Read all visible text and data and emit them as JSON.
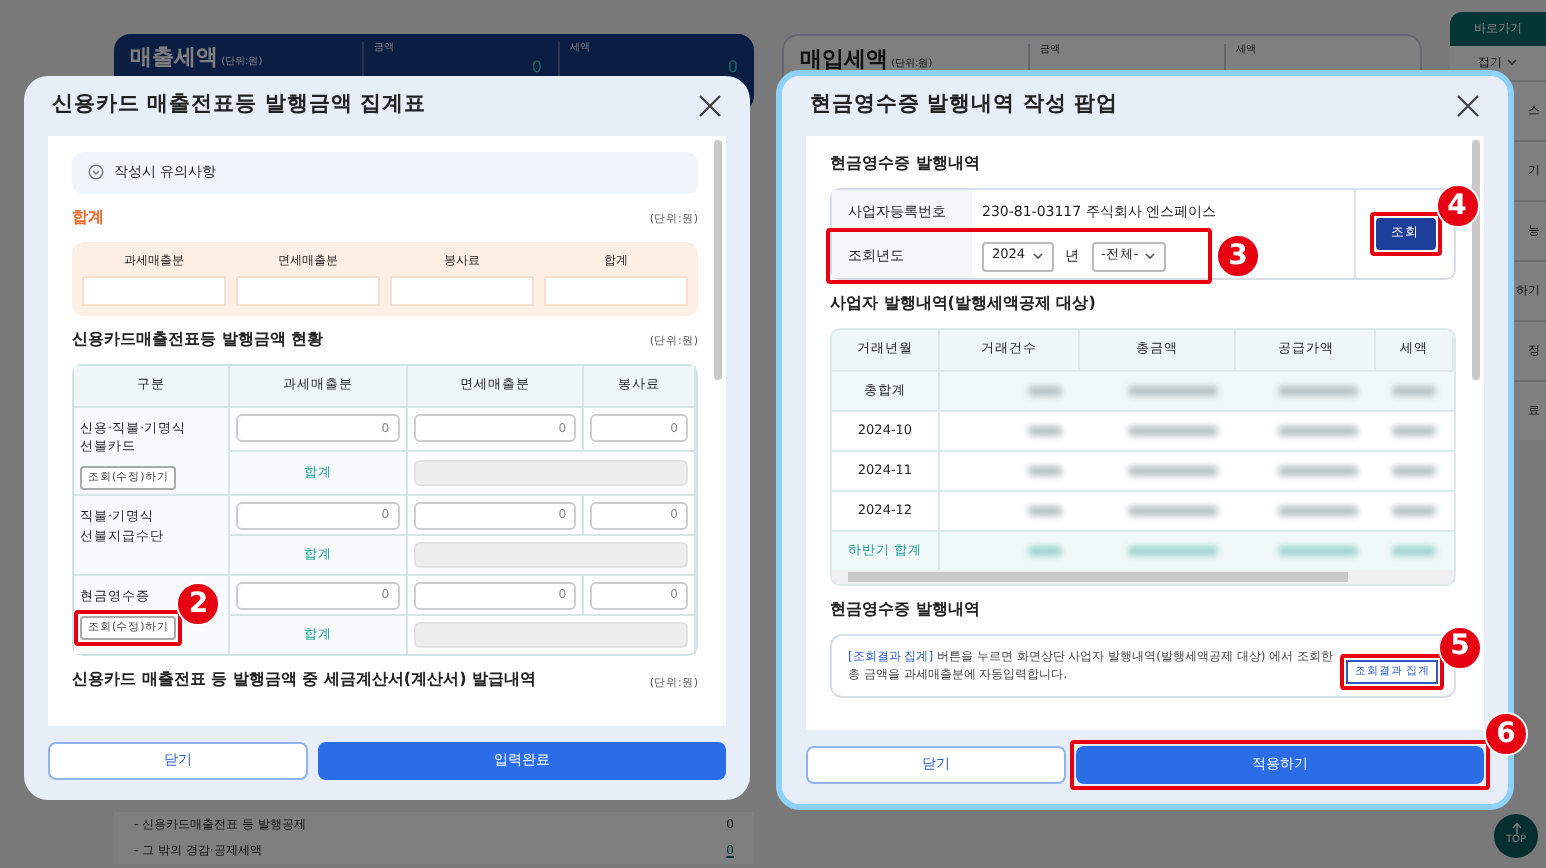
{
  "background": {
    "sales_card": {
      "title": "매출세액",
      "unit": "(단위:원)",
      "columns": [
        "금액",
        "세액"
      ],
      "values": [
        "0",
        "0"
      ]
    },
    "purchase_card": {
      "title": "매입세액",
      "unit": "(단위:원)",
      "columns": [
        "금액",
        "세액"
      ]
    },
    "deduction_rows": [
      {
        "label": "- 신용카드매출전표 등 발행공제",
        "value": "0",
        "link": false
      },
      {
        "label": "- 그 밖의 경감·공제세액",
        "value": "0",
        "link": true
      }
    ],
    "quick_menu": {
      "title": "바로가기",
      "fold": "접기",
      "items": [
        "스",
        "기",
        "능",
        "하기",
        "정",
        "료"
      ]
    },
    "top_button": "TOP"
  },
  "left_modal": {
    "title": "신용카드 매출전표등 발행금액 집계표",
    "notice": "작성시 유의사항",
    "total": {
      "title": "합계",
      "unit": "(단위:원)",
      "columns": [
        "과세매출분",
        "면세매출분",
        "봉사료",
        "합계"
      ]
    },
    "status": {
      "title": "신용카드매출전표등 발행금액 현황",
      "unit": "(단위:원)",
      "columns": [
        "구분",
        "과세매출분",
        "면세매출분",
        "봉사료"
      ],
      "groups": [
        {
          "label": "신용·직불·기명식 선불카드",
          "button": "조회(수정)하기",
          "values": [
            "0",
            "0",
            "0"
          ],
          "sum_label": "합계"
        },
        {
          "label": "직불·기명식 선불지급수단",
          "values": [
            "0",
            "0",
            "0"
          ],
          "sum_label": "합계"
        },
        {
          "label": "현금영수증",
          "button": "조회(수정)하기",
          "values": [
            "0",
            "0",
            "0"
          ],
          "sum_label": "합계"
        }
      ]
    },
    "invoice_section": {
      "title": "신용카드 매출전표 등 발행금액 중 세금계산서(계산서) 발급내역",
      "unit": "(단위:원)"
    },
    "buttons": [
      {
        "label": "닫기",
        "kind": "secondary"
      },
      {
        "label": "입력완료",
        "kind": "primary"
      }
    ]
  },
  "right_modal": {
    "title": "현금영수증 발행내역 작성 팝업",
    "section1": "현금영수증 발행내역",
    "business_number_label": "사업자등록번호",
    "business_number": "230-81-03117  주식회사 엔스페이스",
    "year_label": "조회년도",
    "year": "2024",
    "year_unit": "년",
    "month": "-전체-",
    "search_button": "조회",
    "section2": "사업자 발행내역(발행세액공제 대상)",
    "table": {
      "columns": [
        "거래년월",
        "거래건수",
        "총금액",
        "공급가액",
        "세액"
      ],
      "rows": [
        {
          "label": "총합계",
          "kind": "total"
        },
        {
          "label": "2024-10",
          "kind": "month"
        },
        {
          "label": "2024-11",
          "kind": "month"
        },
        {
          "label": "2024-12",
          "kind": "month"
        },
        {
          "label": "하반기 합계",
          "kind": "subtotal"
        }
      ]
    },
    "section3": "현금영수증 발행내역",
    "info_link": "[조회결과 집계]",
    "info_text": " 버튼을 누르면 화면상단 사업자 발행내역(발행세액공제 대상) 에서 조회한 총 금액을 과세매출분에 자동입력합니다.",
    "aggregate_button": "조회결과 집계",
    "buttons": [
      {
        "label": "닫기",
        "kind": "secondary"
      },
      {
        "label": "적용하기",
        "kind": "primary"
      }
    ]
  },
  "annotations": [
    {
      "number": "2"
    },
    {
      "number": "3"
    },
    {
      "number": "4"
    },
    {
      "number": "5"
    },
    {
      "number": "6"
    }
  ]
}
